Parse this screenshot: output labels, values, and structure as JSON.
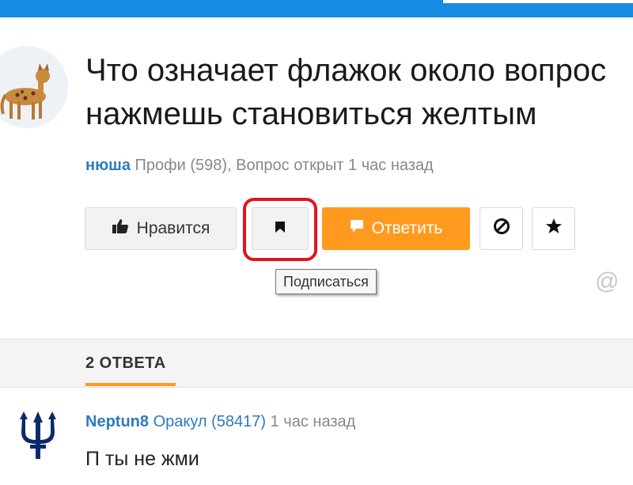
{
  "question": {
    "title_line1": "Что означает флажок около вопрос",
    "title_line2": "нажмешь становиться желтым",
    "author": "нюша",
    "rank": "Профи (598),",
    "status": "Вопрос открыт 1 час назад"
  },
  "actions": {
    "like_label": "Нравится",
    "answer_label": "Ответить",
    "subscribe_tooltip": "Подписаться"
  },
  "answers": {
    "count_label": "2 ОТВЕТА",
    "items": [
      {
        "author": "Neptun8",
        "rank": "Оракул (58417)",
        "time": "1 час назад",
        "text": "П ты не жми"
      }
    ]
  },
  "icons": {
    "like": "thumbs-up-icon",
    "subscribe": "bookmark-flag-icon",
    "answer": "comment-icon",
    "block": "block-icon",
    "favorite": "star-icon",
    "mention": "at-icon"
  },
  "colors": {
    "header": "#168de2",
    "accent": "#ff9a1f",
    "link": "#2b7bc0",
    "highlight": "#e0141e"
  }
}
